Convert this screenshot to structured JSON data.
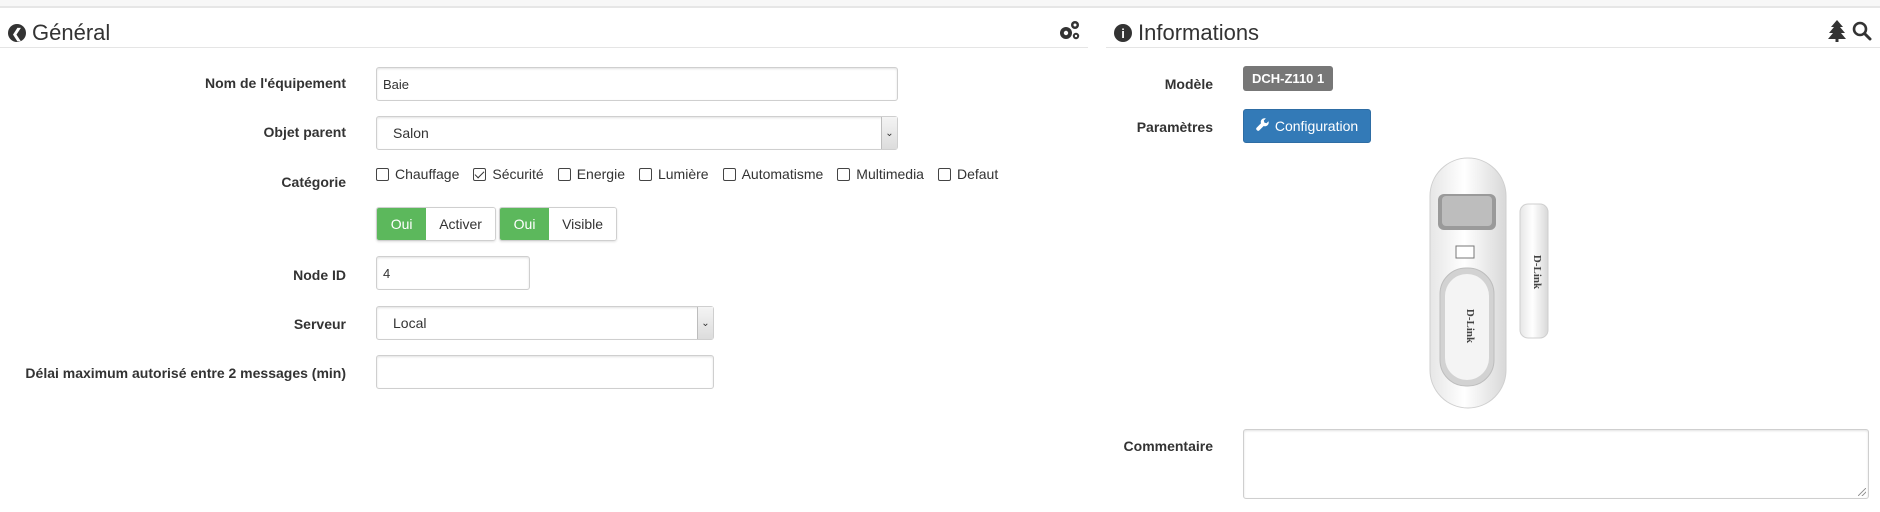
{
  "general": {
    "title": "Général",
    "fields": {
      "name_label": "Nom de l'équipement",
      "name_value": "Baie",
      "parent_label": "Objet parent",
      "parent_value": "Salon",
      "category_label": "Catégorie",
      "categories": [
        {
          "label": "Chauffage",
          "checked": false
        },
        {
          "label": "Sécurité",
          "checked": true
        },
        {
          "label": "Energie",
          "checked": false
        },
        {
          "label": "Lumière",
          "checked": false
        },
        {
          "label": "Automatisme",
          "checked": false
        },
        {
          "label": "Multimedia",
          "checked": false
        },
        {
          "label": "Defaut",
          "checked": false
        }
      ],
      "toggle_activate": {
        "state": "Oui",
        "label": "Activer"
      },
      "toggle_visible": {
        "state": "Oui",
        "label": "Visible"
      },
      "node_label": "Node ID",
      "node_value": "4",
      "server_label": "Serveur",
      "server_value": "Local",
      "delay_label": "Délai maximum autorisé entre 2 messages (min)",
      "delay_value": ""
    }
  },
  "info": {
    "title": "Informations",
    "model_label": "Modèle",
    "model_value": "DCH-Z110 1",
    "params_label": "Paramètres",
    "config_button": "Configuration",
    "comment_label": "Commentaire",
    "device_brand": "D-Link"
  },
  "colors": {
    "success": "#5cb85c",
    "primary": "#337ab7",
    "badge": "#777777"
  }
}
